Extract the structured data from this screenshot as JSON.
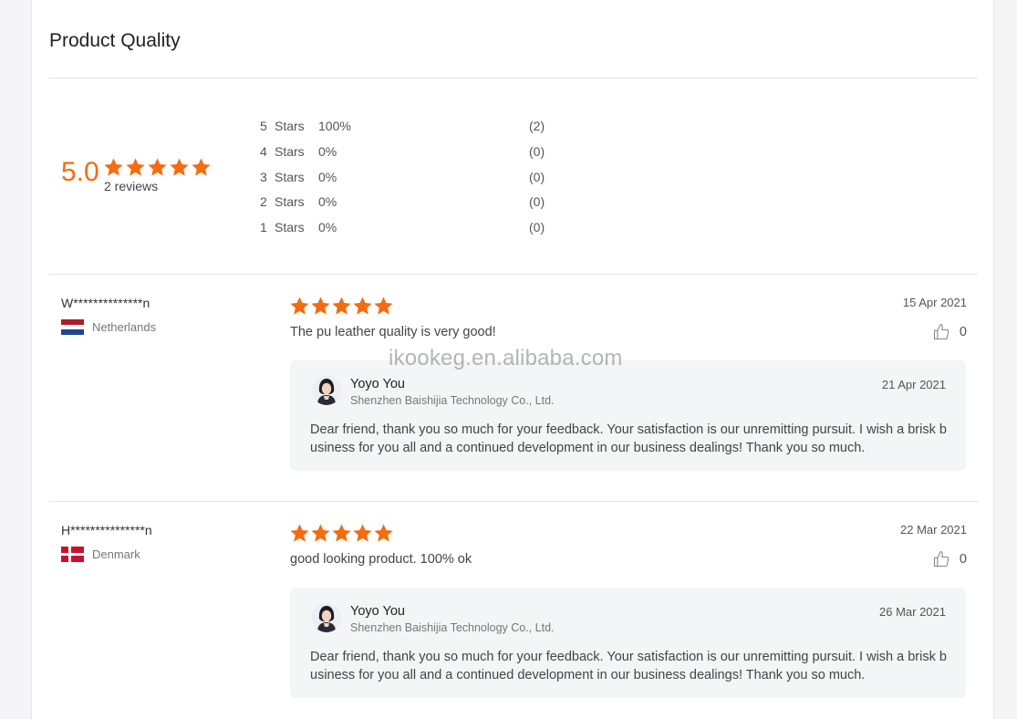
{
  "section": {
    "title": "Product Quality"
  },
  "summary": {
    "score": "5.0",
    "stars": 5,
    "reviews_label": "2 reviews",
    "distribution": [
      {
        "num": "5",
        "label": "Stars",
        "percent": "100%",
        "count": "(2)"
      },
      {
        "num": "4",
        "label": "Stars",
        "percent": "0%",
        "count": "(0)"
      },
      {
        "num": "3",
        "label": "Stars",
        "percent": "0%",
        "count": "(0)"
      },
      {
        "num": "2",
        "label": "Stars",
        "percent": "0%",
        "count": "(0)"
      },
      {
        "num": "1",
        "label": "Stars",
        "percent": "0%",
        "count": "(0)"
      }
    ]
  },
  "reviews": [
    {
      "reviewer": "W**************n",
      "country": "Netherlands",
      "flag": "netherlands-flag",
      "stars": 5,
      "date": "15 Apr 2021",
      "text": "The pu leather quality is very good!",
      "likes": "0",
      "reply": {
        "name": "Yoyo You",
        "company": "Shenzhen Baishijia Technology Co., Ltd.",
        "date": "21 Apr 2021",
        "text": "Dear friend, thank you so much for your feedback. Your satisfaction is our unremitting pursuit. I wish a brisk business for you all and a continued development in our business dealings! Thank you so much."
      }
    },
    {
      "reviewer": "H***************n",
      "country": "Denmark",
      "flag": "denmark-flag",
      "stars": 5,
      "date": "22 Mar 2021",
      "text": "good looking product. 100% ok",
      "likes": "0",
      "reply": {
        "name": "Yoyo You",
        "company": "Shenzhen Baishijia Technology Co., Ltd.",
        "date": "26 Mar 2021",
        "text": "Dear friend, thank you so much for your feedback. Your satisfaction is our unremitting pursuit. I wish a brisk business for you all and a continued development in our business dealings! Thank you so much."
      }
    }
  ],
  "watermark": "ikookeg.en.alibaba.com",
  "colors": {
    "accent": "#f36c10",
    "reply_bg": "#f4f5f7",
    "divider": "#e3e3e6"
  }
}
